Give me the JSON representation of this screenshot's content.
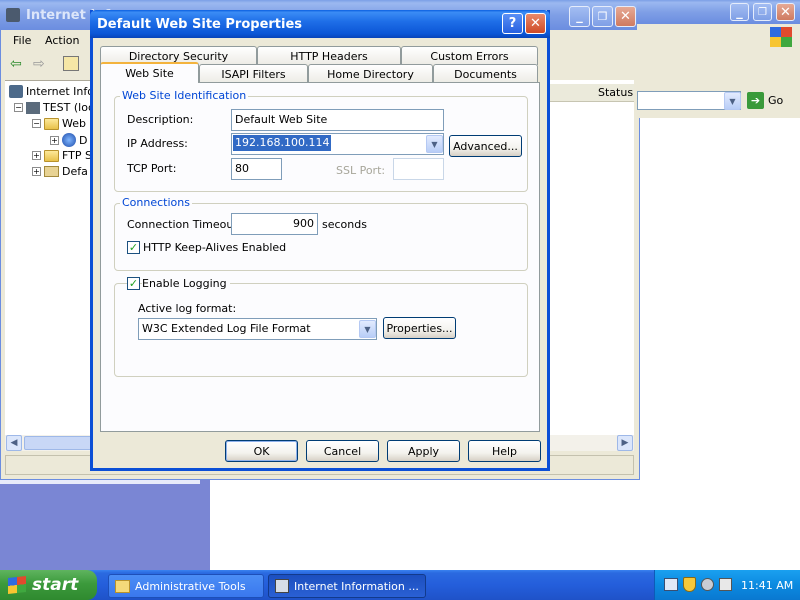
{
  "back_window": {
    "title": "Internet Inf",
    "menu": [
      "File",
      "Action"
    ],
    "status_header": "Status",
    "go_label": "Go",
    "tree": [
      {
        "label": "Internet Info"
      },
      {
        "label": "TEST (loc"
      },
      {
        "label": "Web"
      },
      {
        "label": "D"
      },
      {
        "label": "FTP S"
      },
      {
        "label": "Defa"
      }
    ]
  },
  "back_window2": {
    "min": "_",
    "max": "❐",
    "close": "✕"
  },
  "dialog": {
    "title": "Default Web Site Properties",
    "help_btn": "?",
    "close_btn": "✕",
    "tabs_row1": [
      "Directory Security",
      "HTTP Headers",
      "Custom Errors"
    ],
    "tabs_row2": [
      "Web Site",
      "ISAPI Filters",
      "Home Directory",
      "Documents"
    ],
    "identification": {
      "group_title": "Web Site Identification",
      "description_label": "Description:",
      "description_value": "Default Web Site",
      "ip_label": "IP Address:",
      "ip_value": "192.168.100.114",
      "advanced_button": "Advanced...",
      "tcp_label": "TCP Port:",
      "tcp_value": "80",
      "ssl_label": "SSL Port:",
      "ssl_value": ""
    },
    "connections": {
      "group_title": "Connections",
      "timeout_label": "Connection Timeout:",
      "timeout_value": "900",
      "timeout_unit": "seconds",
      "keepalive_label": "HTTP Keep-Alives Enabled",
      "keepalive_checked": true
    },
    "logging": {
      "enable_label": "Enable Logging",
      "enable_checked": true,
      "format_label": "Active log format:",
      "format_value": "W3C Extended Log File Format",
      "properties_button": "Properties..."
    },
    "buttons": {
      "ok": "OK",
      "cancel": "Cancel",
      "apply": "Apply",
      "help": "Help"
    }
  },
  "taskbar": {
    "start": "start",
    "tasks": [
      "Administrative Tools",
      "Internet Information ..."
    ],
    "clock": "11:41 AM"
  },
  "colors": {
    "accent": "#0b56d6",
    "face": "#ece9d8",
    "group_title": "#0046d5",
    "taskbar": "#245edb",
    "start": "#3c9a3c"
  }
}
